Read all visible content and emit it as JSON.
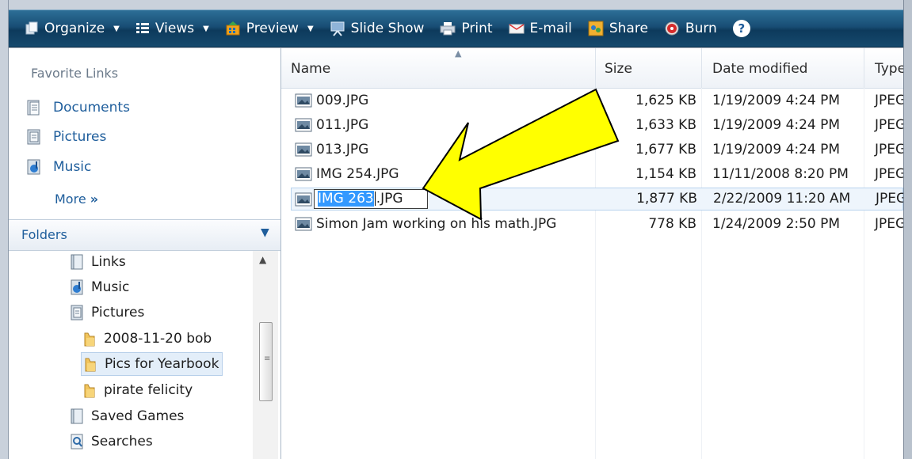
{
  "toolbar": {
    "items": [
      {
        "label": "Organize",
        "icon": "organize-icon",
        "dropdown": true
      },
      {
        "label": "Views",
        "icon": "views-icon",
        "dropdown": true
      },
      {
        "label": "Preview",
        "icon": "preview-icon",
        "dropdown": true
      },
      {
        "label": "Slide Show",
        "icon": "slideshow-icon",
        "dropdown": false
      },
      {
        "label": "Print",
        "icon": "print-icon",
        "dropdown": false
      },
      {
        "label": "E-mail",
        "icon": "email-icon",
        "dropdown": false
      },
      {
        "label": "Share",
        "icon": "share-icon",
        "dropdown": false
      },
      {
        "label": "Burn",
        "icon": "burn-icon",
        "dropdown": false
      }
    ],
    "help_label": "?"
  },
  "nav": {
    "favorites_heading": "Favorite Links",
    "favorites": [
      {
        "label": "Documents",
        "icon": "documents-icon"
      },
      {
        "label": "Pictures",
        "icon": "pictures-icon"
      },
      {
        "label": "Music",
        "icon": "music-icon"
      }
    ],
    "more_label": "More",
    "more_glyph": "»",
    "folders_label": "Folders",
    "folders_chevron": "⌄",
    "tree": [
      {
        "label": "Links",
        "icon": "links-folder-icon"
      },
      {
        "label": "Music",
        "icon": "music-icon"
      },
      {
        "label": "Pictures",
        "icon": "pictures-icon"
      },
      {
        "label": "2008-11-20 bob",
        "icon": "folder-icon"
      },
      {
        "label": "Pics for Yearbook",
        "icon": "folder-icon",
        "selected": true
      },
      {
        "label": "pirate felicity",
        "icon": "folder-icon"
      },
      {
        "label": "Saved Games",
        "icon": "saved-games-icon"
      },
      {
        "label": "Searches",
        "icon": "searches-icon"
      }
    ]
  },
  "list": {
    "columns": [
      "Name",
      "Size",
      "Date modified",
      "Type"
    ],
    "rows": [
      {
        "name": "009.JPG",
        "size": "1,625 KB",
        "date": "1/19/2009 4:24 PM",
        "type": "JPEG"
      },
      {
        "name": "011.JPG",
        "size": "1,633 KB",
        "date": "1/19/2009 4:24 PM",
        "type": "JPEG"
      },
      {
        "name": "013.JPG",
        "size": "1,677 KB",
        "date": "1/19/2009 4:24 PM",
        "type": "JPEG"
      },
      {
        "name": "IMG 254.JPG",
        "size": "1,154 KB",
        "date": "11/11/2008 8:20 PM",
        "type": "JPEG"
      },
      {
        "name": "IMG 263.JPG",
        "size": "1,877 KB",
        "date": "2/22/2009 11:20 AM",
        "type": "JPEG",
        "editing": true,
        "rename_selected": "IMG 263",
        "rename_rest": ".JPG"
      },
      {
        "name": "Simon Jam working on his math.JPG",
        "size": "778 KB",
        "date": "1/24/2009 2:50 PM",
        "type": "JPEG"
      }
    ]
  },
  "colors": {
    "toolbar": "#184d74",
    "link": "#1f5e9c",
    "selection": "#3399ff",
    "arrow_fill": "#ffff00"
  }
}
